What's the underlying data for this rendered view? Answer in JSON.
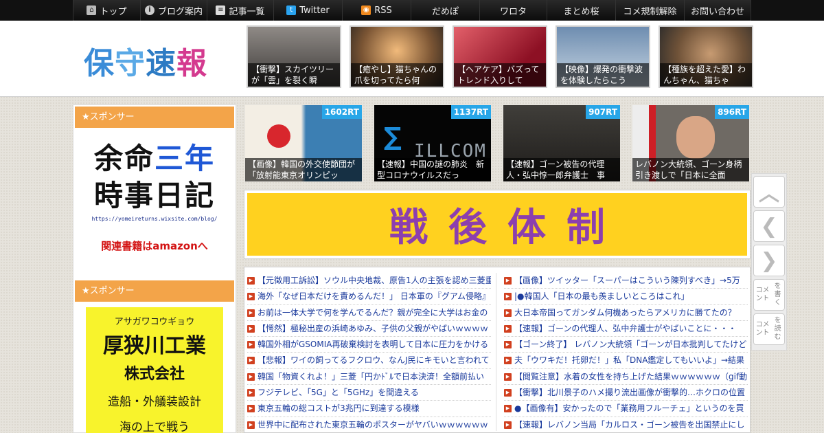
{
  "nav": {
    "items": [
      {
        "label": "トップ",
        "icon": "home-icon"
      },
      {
        "label": "ブログ案内",
        "icon": "info-icon"
      },
      {
        "label": "記事一覧",
        "icon": "list-icon"
      },
      {
        "label": "Twitter",
        "icon": "twitter-icon"
      },
      {
        "label": "RSS",
        "icon": "rss-icon"
      },
      {
        "label": "だめぽ"
      },
      {
        "label": "ワロタ"
      },
      {
        "label": "まとめ桜"
      },
      {
        "label": "コメ規制解除"
      },
      {
        "label": "お問い合わせ"
      }
    ]
  },
  "header": {
    "logo": {
      "c1": "保",
      "c2": "守",
      "c3": "速",
      "c4": "報"
    },
    "thumbs": [
      {
        "caption": "【衝撃】スカイツリーが「雲」を裂く瞬"
      },
      {
        "caption": "【癒やし】猫ちゃんの爪を切ってたら何"
      },
      {
        "caption": "【ヘアケア】バズってトレンド入りして"
      },
      {
        "caption": "【映像】爆発の衝撃波を体験したらこう"
      },
      {
        "caption": "【種族を超えた愛】わんちゃん、猫ちゃ"
      }
    ]
  },
  "sidebar": {
    "sponsor_label_1": "★スポンサー",
    "sponsor_label_2": "★スポンサー",
    "ad1": {
      "line1_a": "余命",
      "line1_b": "三年",
      "line2": "時事日記",
      "url": "https://yomeireturns.wixsite.com/blog/",
      "amazon": "関連書籍はamazonへ"
    },
    "ad2": {
      "kana": "アサガワコウギョウ",
      "name": "厚狭川工業",
      "company": "株式会社",
      "desc": "造船・外艤装設計",
      "more": "海の上で戦う"
    }
  },
  "rt_cards": [
    {
      "badge": "1602RT",
      "caption": "【画像】韓国の外交使節団が「放射能東京オリンピッ"
    },
    {
      "badge": "1137RT",
      "caption": "【速報】中国の謎の肺炎　新型コロナウイルスだっ",
      "logo_text": "ILLCOM"
    },
    {
      "badge": "907RT",
      "caption": "【速報】ゴーン被告の代理人・弘中惇一郎弁護士　事"
    },
    {
      "badge": "896RT",
      "caption": "レバノン大統領、ゴーン身柄引き渡しで「日本に全面"
    }
  ],
  "banner": {
    "text": "戦後体制"
  },
  "news": {
    "left": [
      "【元徴用工訴訟】ソウル中央地裁、原告1人の主張を認め三菱重",
      "海外「なぜ日本だけを責めるんだ！」 日本軍の『グアム侵略』",
      "お前は一体大学で何を学んでるんだ？親が完全に大学はお金の",
      "【愕然】極秘出産の浜崎あゆみ、子供の父親がやばいｗｗｗｗ",
      "韓国外相がGSOMIA再破棄検討を表明して日本に圧力をかける",
      "【悲報】ワイの飼ってるフクロウ、なんJ民にキモいと言われて",
      "韓国「物資くれよ！」三菱「円かﾄﾞﾙで日本決済！全額前払い",
      "フジテレビ、「5G」と「5GHz」を間違える",
      "東京五輪の総コストが3兆円に到達する模様",
      "世界中に配布された東京五輪のポスターがヤバいｗｗｗｗｗｗ"
    ],
    "right": [
      "【画像】ツイッター「スーパーはこういう陳列すべき」→5万",
      "|●韓国人「日本の最も羨ましいところはこれ」",
      "大日本帝国ってガンダム何機あったらアメリカに勝てたの？",
      "【速報】ゴーンの代理人、弘中弁護士がやばいことに・・・",
      "【ゴーン終了】 レバノン大統領「ゴーンが日本批判してたけど",
      "夫「ウワキだ！托卵だ！」私「DNA鑑定してもいいよ」→結果",
      "【閲覧注意】水着の女性を持ち上げた結果ｗｗｗｗｗｗ（gif動",
      "【衝撃】北川景子のハメ撮り流出画像が衝撃的…ホクロの位置",
      "●【画像有】安かったので「業務用フルーチェ」というのを買",
      "【速報】レバノン当局「カルロス・ゴーン被告を出国禁止にし"
    ]
  },
  "float_buttons": {
    "up": "up-chevron-icon",
    "back": "left-chevron-icon",
    "forward": "right-chevron-icon",
    "write_comment": "コメントを書く",
    "read_comment": "コメントを読む"
  }
}
